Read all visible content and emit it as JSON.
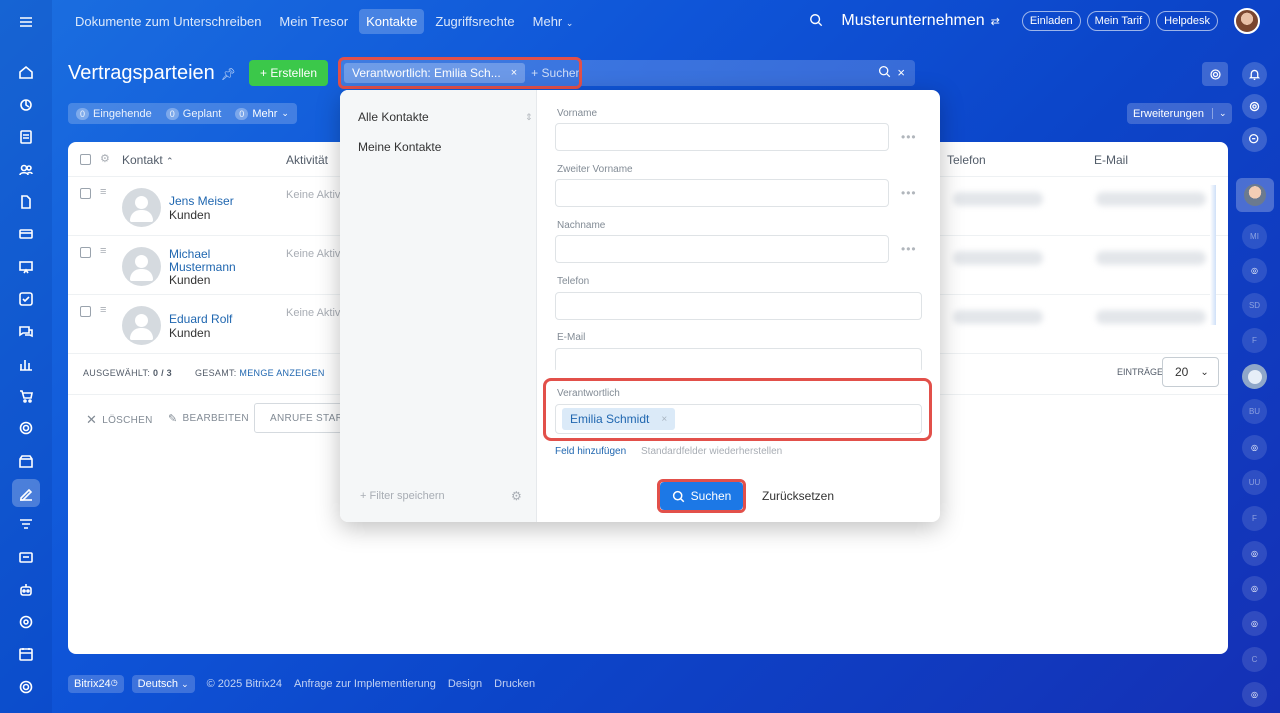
{
  "top_nav": {
    "items": [
      "Dokumente zum Unterschreiben",
      "Mein Tresor",
      "Kontakte",
      "Zugriffsrechte",
      "Mehr"
    ],
    "active_index": 2
  },
  "top_right": {
    "company": "Musterunternehmen",
    "invite": "Einladen",
    "tariff": "Mein Tarif",
    "helpdesk": "Helpdesk"
  },
  "page": {
    "title": "Vertragsparteien",
    "create_label": "+ Erstellen"
  },
  "search": {
    "chip": "Verantwortlich: Emilia Sch...",
    "placeholder": "+ Suchen"
  },
  "counters": {
    "incoming_count": "0",
    "incoming": "Eingehende",
    "planned_count": "0",
    "planned": "Geplant",
    "more_count": "0",
    "more": "Mehr"
  },
  "extensions_label": "Erweiterungen",
  "grid": {
    "columns": {
      "contact": "Kontakt",
      "activity": "Aktivität",
      "phone": "Telefon",
      "email": "E-Mail"
    },
    "rows": [
      {
        "name": "Jens Meiser",
        "type": "Kunden",
        "activity": "Keine Aktivi"
      },
      {
        "name": "Michael Mustermann",
        "type": "Kunden",
        "activity": "Keine Aktivi"
      },
      {
        "name": "Eduard Rolf",
        "type": "Kunden",
        "activity": "Keine Aktivi"
      }
    ],
    "selected_label": "AUSGEWÄHLT:",
    "selected_value": "0 / 3",
    "total_label": "GESAMT:",
    "total_link": "MENGE ANZEIGEN",
    "entries_label": "EINTRÄGE",
    "entries_value": "20",
    "delete_label": "LÖSCHEN",
    "edit_label": "BEARBEITEN",
    "calls_label": "ANRUFE STARTEN"
  },
  "filter_popup": {
    "presets": [
      "Alle Kontakte",
      "Meine Kontakte"
    ],
    "save_filter": "+ Filter speichern",
    "fields": {
      "first_name": "Vorname",
      "middle_name": "Zweiter Vorname",
      "last_name": "Nachname",
      "phone": "Telefon",
      "email": "E-Mail",
      "responsible": "Verantwortlich"
    },
    "responsible_value": "Emilia Schmidt",
    "add_field": "Feld hinzufügen",
    "restore_fields": "Standardfelder wiederherstellen",
    "search_button": "Suchen",
    "reset_button": "Zurücksetzen"
  },
  "right_rail": {
    "initials": [
      "MI",
      "SD",
      "F",
      "BU",
      "UU",
      "F",
      "C"
    ]
  },
  "footer": {
    "brand": "Bitrix24",
    "language": "Deutsch",
    "copyright": "© 2025 Bitrix24",
    "impl_request": "Anfrage zur Implementierung",
    "design": "Design",
    "print": "Drucken"
  }
}
